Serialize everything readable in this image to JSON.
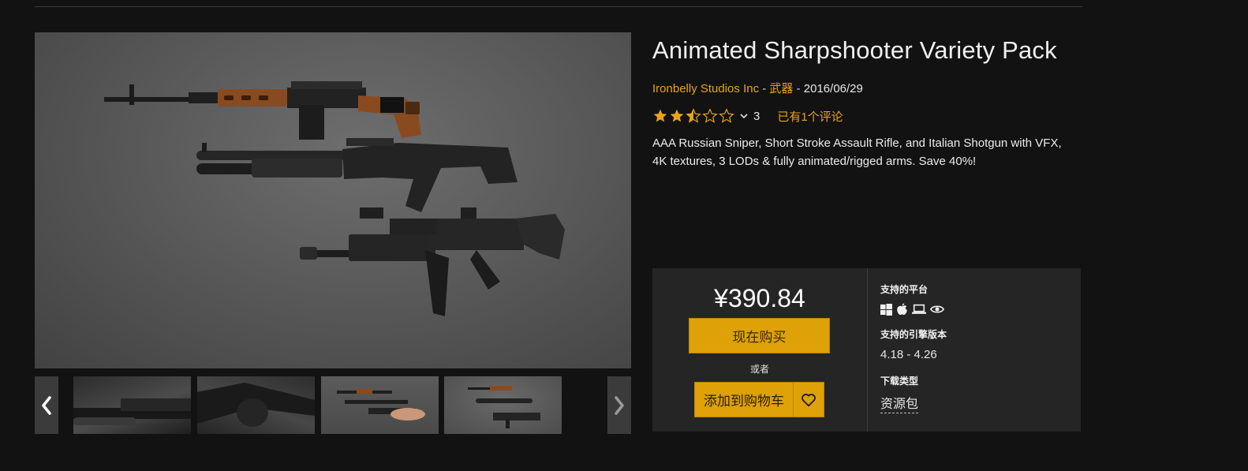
{
  "product": {
    "title": "Animated Sharpshooter Variety Pack",
    "seller": "Ironbelly Studios Inc",
    "category": "武器",
    "meta_separator": " - ",
    "date": "2016/06/29",
    "rating": {
      "stars_filled": 2.5,
      "stars_total": 5,
      "count": "3",
      "reviews_link": "已有1个评论"
    },
    "description": "AAA Russian Sniper, Short Stroke Assault Rifle, and Italian Shotgun with VFX, 4K textures, 3 LODs & fully animated/rigged arms. Save 40%!"
  },
  "purchase": {
    "price": "¥390.84",
    "buy_now_label": "现在购买",
    "or_text": "或者",
    "add_to_cart_label": "添加到购物车",
    "wishlist_icon": "heart-icon"
  },
  "specs": {
    "platforms_label": "支持的平台",
    "platform_icons": [
      "windows-icon",
      "apple-icon",
      "laptop-icon",
      "eye-icon"
    ],
    "engine_label": "支持的引擎版本",
    "engine_versions": "4.18 - 4.26",
    "download_label": "下载类型",
    "download_type": "资源包"
  },
  "gallery": {
    "prev_icon": "chevron-left-icon",
    "next_icon": "chevron-right-icon",
    "thumbnail_count": 4
  },
  "colors": {
    "accent": "#e8a317",
    "button": "#dea108",
    "background": "#121212",
    "panel": "#252525"
  }
}
